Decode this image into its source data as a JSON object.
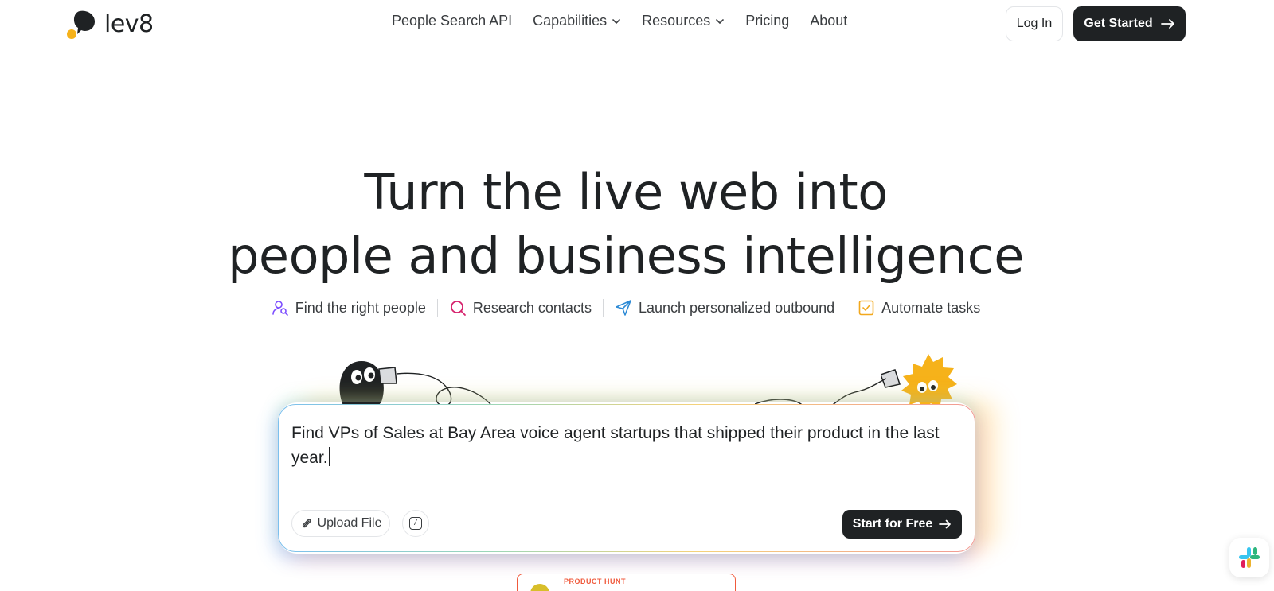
{
  "brand": {
    "name": "lev8"
  },
  "nav": {
    "links": [
      {
        "label": "People Search API",
        "dropdown": false
      },
      {
        "label": "Capabilities",
        "dropdown": true
      },
      {
        "label": "Resources",
        "dropdown": true
      },
      {
        "label": "Pricing",
        "dropdown": false
      },
      {
        "label": "About",
        "dropdown": false
      }
    ],
    "login_label": "Log In",
    "get_started_label": "Get Started"
  },
  "hero": {
    "title_line1": "Turn the live web into",
    "title_line2": "people and business intelligence",
    "features": [
      {
        "label": "Find the right people",
        "icon": "user-search-icon",
        "color": "#7c4dff"
      },
      {
        "label": "Research contacts",
        "icon": "search-icon",
        "color": "#d6246e"
      },
      {
        "label": "Launch personalized outbound",
        "icon": "send-icon",
        "color": "#2e8bd6"
      },
      {
        "label": "Automate tasks",
        "icon": "checkbox-icon",
        "color": "#f2a81d"
      }
    ]
  },
  "prompt": {
    "text": "Find VPs of Sales at Bay Area voice agent startups that shipped their product in the last year.",
    "upload_label": "Upload File",
    "start_label": "Start for Free"
  },
  "product_hunt": {
    "label": "PRODUCT HUNT"
  },
  "colors": {
    "accent_yellow": "#f6b21a",
    "dark": "#1f2224"
  }
}
